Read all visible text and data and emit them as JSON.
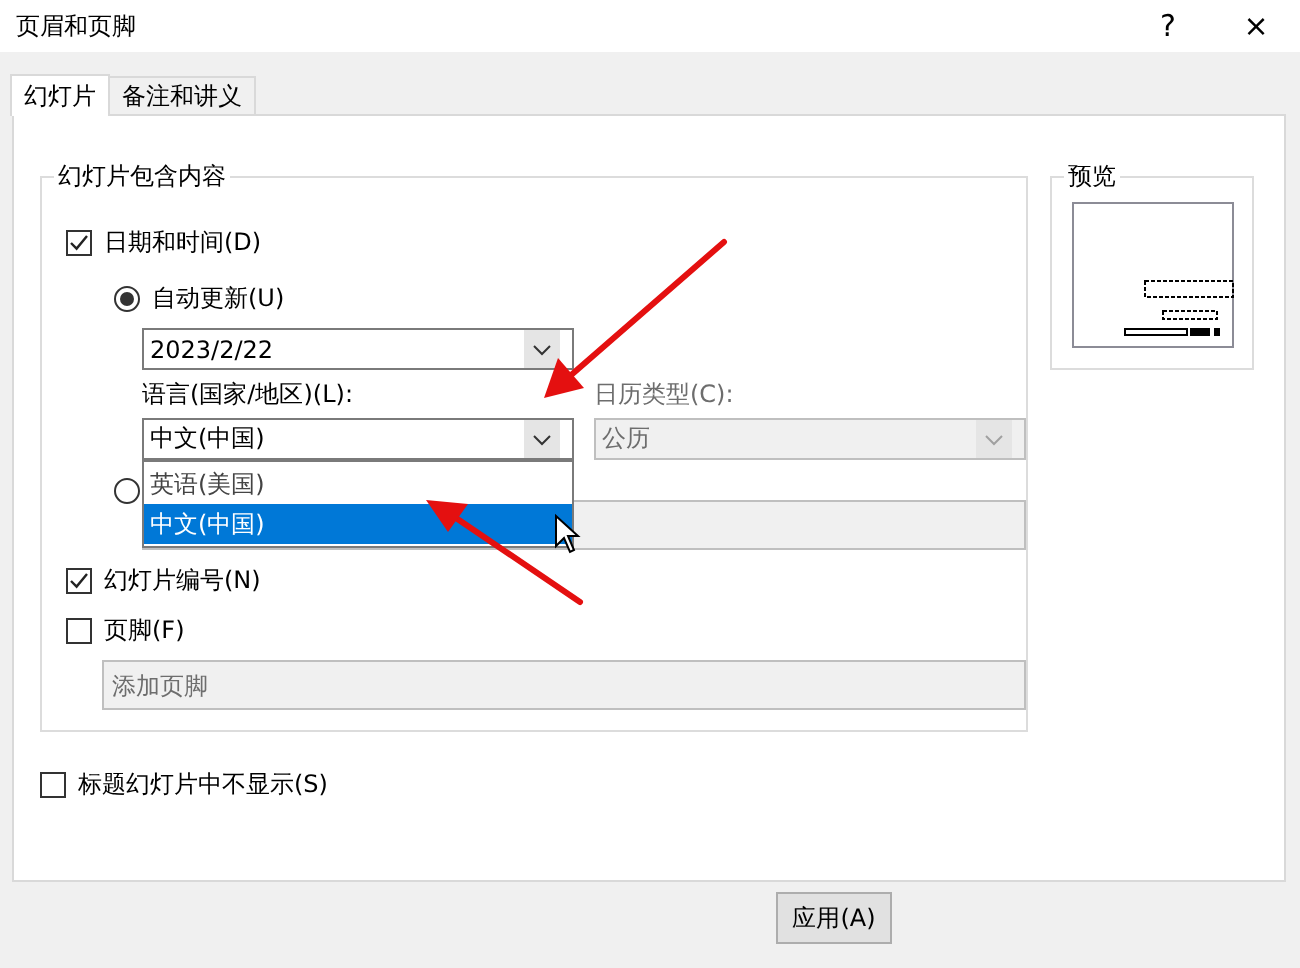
{
  "window": {
    "title": "页眉和页脚",
    "help": "?",
    "close": "×"
  },
  "tabs": [
    {
      "label": "幻灯片",
      "selected": true
    },
    {
      "label": "备注和讲义",
      "selected": false
    }
  ],
  "include_group": {
    "title": "幻灯片包含内容",
    "date_time": {
      "label": "日期和时间(D)",
      "checked": true
    },
    "auto_update": {
      "label": "自动更新(U)",
      "selected": true,
      "date_value": "2023/2/22",
      "language_label": "语言(国家/地区)(L):",
      "language_value": "中文(中国)",
      "language_expanded": true,
      "language_options": [
        {
          "label": "英语(美国)",
          "selected": false
        },
        {
          "label": "中文(中国)",
          "selected": true
        }
      ],
      "calendar_label": "日历类型(C):",
      "calendar_value": "公历",
      "calendar_disabled": true
    },
    "fixed": {
      "selected": false,
      "disabled": true
    },
    "slide_number": {
      "label": "幻灯片编号(N)",
      "checked": true
    },
    "footer": {
      "label": "页脚(F)",
      "checked": false,
      "placeholder": "添加页脚"
    }
  },
  "preview": {
    "title": "预览"
  },
  "dont_show_on_title": {
    "label": "标题幻灯片中不显示(S)",
    "checked": false
  },
  "buttons": [
    {
      "label": "应用(A)"
    }
  ]
}
